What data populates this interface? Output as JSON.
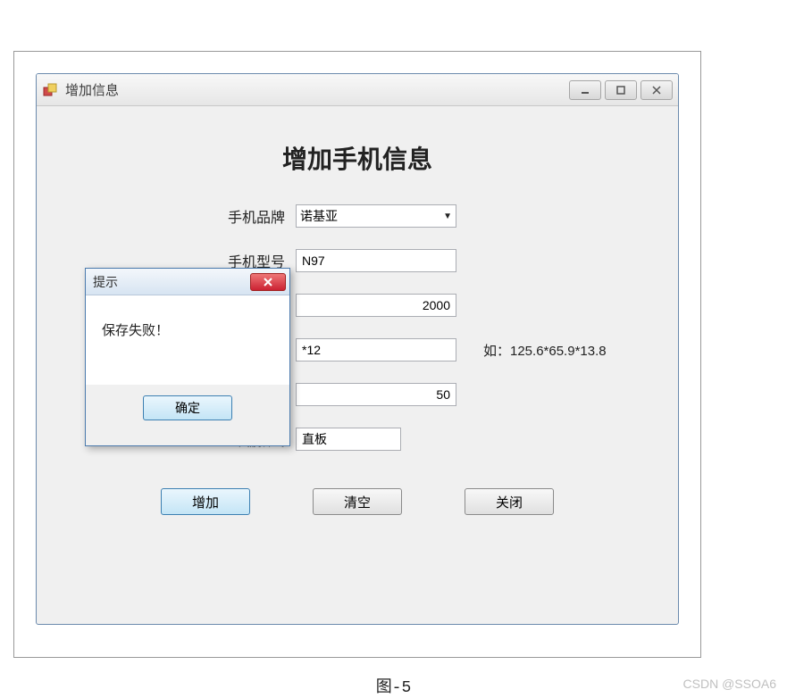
{
  "window": {
    "title": "增加信息"
  },
  "page": {
    "heading": "增加手机信息",
    "labels": {
      "brand": "手机品牌",
      "model": "手机型号",
      "price": "",
      "size": "",
      "weight": "",
      "style": "终端款式"
    },
    "values": {
      "brand": "诺基亚",
      "model": "N97",
      "price": "2000",
      "size_partial": "*12",
      "weight": "50",
      "style": "直板"
    },
    "hint": "如：125.6*65.9*13.8",
    "buttons": {
      "add": "增加",
      "clear": "清空",
      "close": "关闭"
    }
  },
  "modal": {
    "title": "提示",
    "message": "保存失败！",
    "ok": "确定"
  },
  "caption": "图-5",
  "watermark": "CSDN @SSOA6"
}
